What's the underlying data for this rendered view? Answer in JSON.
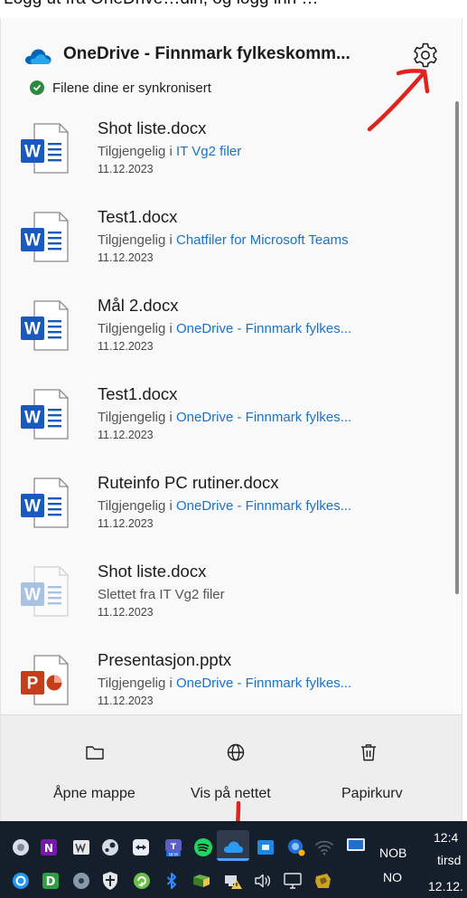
{
  "caption": "Logg ut fra OneDrive…din, og logg inn …",
  "panel": {
    "title": "OneDrive - Finnmark fylkeskomm...",
    "sync_status": "Filene dine er synkronisert"
  },
  "files": [
    {
      "name": "Shot liste.docx",
      "prefix": "Tilgjengelig i ",
      "location": "IT Vg2 filer",
      "date": "11.12.2023",
      "type": "word",
      "state": "available"
    },
    {
      "name": "Test1.docx",
      "prefix": "Tilgjengelig i ",
      "location": "Chatfiler for Microsoft Teams",
      "date": "11.12.2023",
      "type": "word",
      "state": "available"
    },
    {
      "name": "Mål 2.docx",
      "prefix": "Tilgjengelig i ",
      "location": "OneDrive - Finnmark fylkes...",
      "date": "11.12.2023",
      "type": "word",
      "state": "available"
    },
    {
      "name": "Test1.docx",
      "prefix": "Tilgjengelig i ",
      "location": "OneDrive - Finnmark fylkes...",
      "date": "11.12.2023",
      "type": "word",
      "state": "available"
    },
    {
      "name": "Ruteinfo PC rutiner.docx",
      "prefix": "Tilgjengelig i ",
      "location": "OneDrive - Finnmark fylkes...",
      "date": "11.12.2023",
      "type": "word",
      "state": "available"
    },
    {
      "name": "Shot liste.docx",
      "prefix": "Slettet fra IT Vg2 filer",
      "location": "",
      "date": "11.12.2023",
      "type": "word",
      "state": "deleted"
    },
    {
      "name": "Presentasjon.pptx",
      "prefix": "Tilgjengelig i ",
      "location": "OneDrive - Finnmark fylkes...",
      "date": "11.12.2023",
      "type": "powerpoint",
      "state": "available"
    }
  ],
  "footer": {
    "open_folder": "Åpne mappe",
    "view_online": "Vis på nettet",
    "recycle_bin": "Papirkurv"
  },
  "taskbar": {
    "language_top": "NOB",
    "language_bottom": "NO",
    "time": "12:4",
    "weekday": "tirsd",
    "date": "12.12."
  },
  "colors": {
    "accent": "#1a73c8",
    "word_blue": "#185abd",
    "powerpoint_red": "#c43e1c",
    "sync_green": "#2b8a3e",
    "annotation_red": "#e0231c"
  }
}
